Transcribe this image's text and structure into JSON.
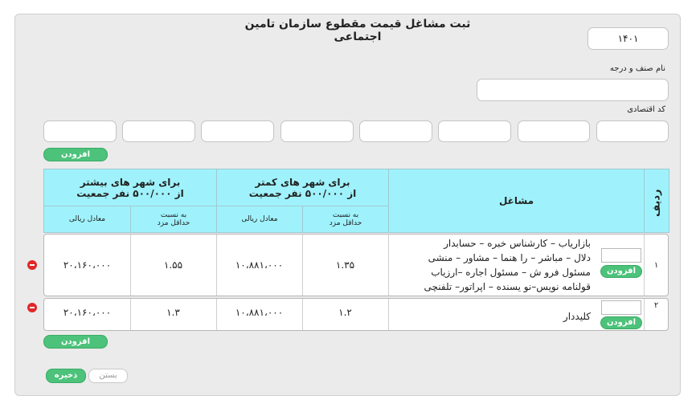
{
  "form": {
    "title": "ثبت مشاغل قیمت مقطوع سازمان تامین اجتماعی",
    "year": "۱۴۰۱",
    "guild_label": "نام صنف و درجه",
    "guild_value": "",
    "economic_code_label": "کد اقتصادی",
    "economic_code_fields": [
      "",
      "",
      "",
      "",
      "",
      "",
      "",
      ""
    ],
    "add_code_label": "افزودن"
  },
  "table": {
    "col_row": "ردیف",
    "col_jobs": "مشاغل",
    "group_small": "برای شهر های کمتر از ۵۰۰/۰۰۰ نفر جمعیت",
    "group_small_l1": "برای شهر های کمتر",
    "group_small_l2": "از ۵۰۰/۰۰۰ نفر جمعیت",
    "group_large_l1": "برای شهر های بیشتر",
    "group_large_l2": "از ۵۰۰/۰۰۰ نفر جمعیت",
    "sub_ratio_l1": "به نسبت",
    "sub_ratio_l2": "حداقل مزد",
    "sub_rial": "معادل ریالی",
    "rows": [
      {
        "index": "۱",
        "job_lines": [
          "بازاریاب – کارشناس خبره – حسابدار",
          "دلال – مباشر – را هنما – مشاور – منشی",
          "مسئول فرو ش – مسئول اجاره –ارزیاب",
          "قولنامه نویس–نو یسنده – اپراتور– تلفنچی"
        ],
        "small_ratio": "۱.۳۵",
        "small_rial": "۱۰،۸۸۱،۰۰۰",
        "large_ratio": "۱.۵۵",
        "large_rial": "۲۰،۱۶۰،۰۰۰",
        "input_value": "",
        "add_label": "افزودن"
      },
      {
        "index": "۲",
        "job_lines": [
          "کلیددار"
        ],
        "small_ratio": "۱.۲",
        "small_rial": "۱۰،۸۸۱،۰۰۰",
        "large_ratio": "۱.۳",
        "large_rial": "۲۰،۱۶۰،۰۰۰",
        "input_value": "",
        "add_label": "افزودن"
      }
    ],
    "add_row_label": "افزودن"
  },
  "footer": {
    "save_label": "ذخیره",
    "close_label": "بستن"
  },
  "colors": {
    "header": "#9ff2fb",
    "green": "#4cc27a",
    "remove": "#e02828"
  }
}
